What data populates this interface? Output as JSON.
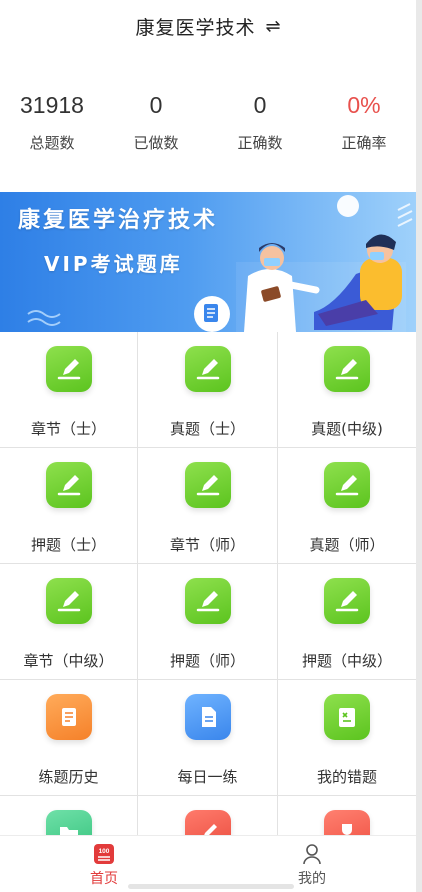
{
  "header": {
    "title": "康复医学技术",
    "swap_icon": "⇌"
  },
  "stats": [
    {
      "value": "31918",
      "label": "总题数"
    },
    {
      "value": "0",
      "label": "已做数"
    },
    {
      "value": "0",
      "label": "正确数"
    },
    {
      "value": "0%",
      "label": "正确率"
    }
  ],
  "banner": {
    "line1": "康复医学治疗技术",
    "line2": "VIP考试题库"
  },
  "grid": [
    {
      "label": "章节（士）",
      "icon": "pencil-icon",
      "color": "green"
    },
    {
      "label": "真题（士）",
      "icon": "pencil-icon",
      "color": "green"
    },
    {
      "label": "真题(中级)",
      "icon": "pencil-icon",
      "color": "green"
    },
    {
      "label": "押题（士）",
      "icon": "pencil-icon",
      "color": "green"
    },
    {
      "label": "章节（师）",
      "icon": "pencil-icon",
      "color": "green"
    },
    {
      "label": "真题（师）",
      "icon": "pencil-icon",
      "color": "green"
    },
    {
      "label": "章节（中级）",
      "icon": "pencil-icon",
      "color": "green"
    },
    {
      "label": "押题（师）",
      "icon": "pencil-icon",
      "color": "green"
    },
    {
      "label": "押题（中级）",
      "icon": "pencil-icon",
      "color": "green"
    },
    {
      "label": "练题历史",
      "icon": "scroll-icon",
      "color": "orange"
    },
    {
      "label": "每日一练",
      "icon": "document-icon",
      "color": "blue"
    },
    {
      "label": "我的错题",
      "icon": "wrong-book-icon",
      "color": "green"
    }
  ],
  "tabbar": [
    {
      "label": "首页",
      "icon": "home-100-icon",
      "active": true
    },
    {
      "label": "我的",
      "icon": "user-icon",
      "active": false
    }
  ],
  "colors": {
    "accent_red": "#e23b3b",
    "green": "#5cc41f",
    "banner_blue": "#2e7fe6"
  }
}
